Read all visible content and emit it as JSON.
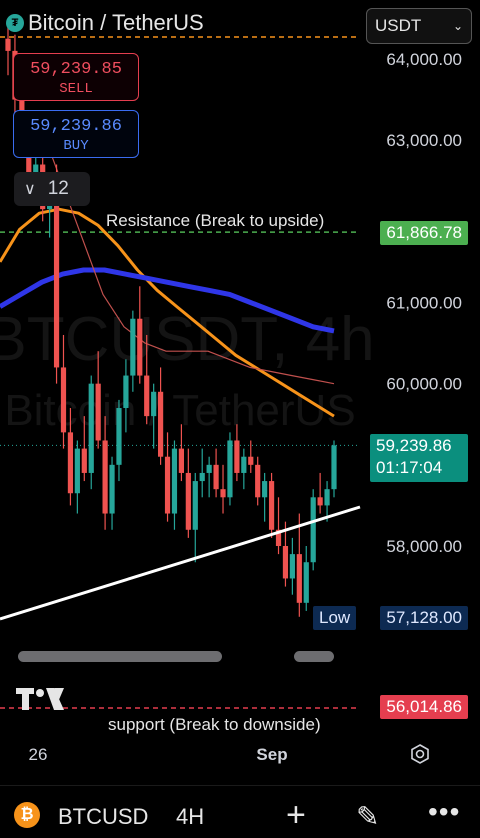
{
  "header": {
    "title": "Bitcoin / TetherUS",
    "quote_select": "USDT"
  },
  "trade": {
    "sell_price": "59,239.85",
    "sell_label": "SELL",
    "buy_price": "59,239.86",
    "buy_label": "BUY",
    "indicator_count": "12"
  },
  "watermark": {
    "line1": "BTCUSDT, 4h",
    "line2": "Bitcoin / TetherUS"
  },
  "price_tags": {
    "resistance": "61,866.78",
    "last": "59,239.86",
    "countdown": "01:17:04",
    "low_label": "Low",
    "low": "57,128.00",
    "support": "56,014.86"
  },
  "annotations": {
    "resistance": "Resistance (Break to upside)",
    "support": "support (Break to downside)"
  },
  "footer": {
    "symbol": "BTCUSD",
    "interval": "4H"
  },
  "colors": {
    "up": "#26a69a",
    "down": "#ef5350",
    "ema_orange": "#f7931a",
    "ma_blue": "#2f36e8",
    "ma_red": "#c0504d",
    "ma_green": "#4c9a4c",
    "resistance": "#4caf50",
    "support": "#e53e4f"
  },
  "chart_data": {
    "type": "candlestick",
    "title": "Bitcoin / TetherUS",
    "y_tick_labels": [
      "64,000.00",
      "63,000.00",
      "61,000.00",
      "60,000.00",
      "58,000.00"
    ],
    "x_tick_labels": [
      "26",
      "Sep"
    ],
    "ylim": [
      55900,
      64300
    ],
    "grid": false,
    "candles": [
      [
        64250,
        64400,
        63800,
        64100
      ],
      [
        64100,
        64300,
        63300,
        63500
      ],
      [
        63500,
        63900,
        62900,
        63100
      ],
      [
        63100,
        63300,
        62400,
        62600
      ],
      [
        62600,
        62900,
        62300,
        62700
      ],
      [
        62700,
        62800,
        62000,
        62150
      ],
      [
        62150,
        62600,
        61800,
        62400
      ],
      [
        62300,
        62700,
        60000,
        60200
      ],
      [
        60200,
        60600,
        59200,
        59400
      ],
      [
        59400,
        59700,
        58500,
        58650
      ],
      [
        58650,
        59300,
        58400,
        59200
      ],
      [
        59200,
        59600,
        58800,
        58900
      ],
      [
        58900,
        60100,
        58700,
        60000
      ],
      [
        60000,
        60400,
        59200,
        59300
      ],
      [
        59300,
        59600,
        58200,
        58400
      ],
      [
        58400,
        59100,
        58200,
        59000
      ],
      [
        59000,
        59800,
        58800,
        59700
      ],
      [
        59700,
        60300,
        59400,
        60100
      ],
      [
        60100,
        60900,
        59900,
        60800
      ],
      [
        60800,
        61200,
        60000,
        60100
      ],
      [
        60100,
        60600,
        59500,
        59600
      ],
      [
        59600,
        60000,
        59200,
        59900
      ],
      [
        59900,
        60200,
        59000,
        59100
      ],
      [
        59100,
        59400,
        58300,
        58400
      ],
      [
        58400,
        59300,
        58200,
        59200
      ],
      [
        59200,
        59500,
        58800,
        58900
      ],
      [
        58900,
        59200,
        58100,
        58200
      ],
      [
        58200,
        58900,
        57800,
        58800
      ],
      [
        58800,
        59200,
        58600,
        58900
      ],
      [
        58900,
        59100,
        58600,
        59000
      ],
      [
        59000,
        59200,
        58600,
        58700
      ],
      [
        58700,
        59000,
        58400,
        58600
      ],
      [
        58600,
        59400,
        58500,
        59300
      ],
      [
        59300,
        59500,
        58800,
        58900
      ],
      [
        58900,
        59200,
        58700,
        59100
      ],
      [
        59100,
        59300,
        58900,
        59000
      ],
      [
        59000,
        59100,
        58500,
        58600
      ],
      [
        58600,
        58900,
        58300,
        58800
      ],
      [
        58800,
        58900,
        58100,
        58200
      ],
      [
        58200,
        58600,
        57900,
        58000
      ],
      [
        58000,
        58300,
        57500,
        57600
      ],
      [
        57600,
        58100,
        57400,
        57900
      ],
      [
        57900,
        58400,
        57128,
        57300
      ],
      [
        57300,
        58000,
        57200,
        57800
      ],
      [
        57800,
        58700,
        57700,
        58600
      ],
      [
        58600,
        58900,
        58400,
        58500
      ],
      [
        58500,
        58800,
        58300,
        58700
      ],
      [
        58700,
        59300,
        58600,
        59240
      ]
    ],
    "series": [
      {
        "values": [
          61500,
          61900,
          62100,
          62150,
          62100,
          61950,
          61700,
          61400,
          61150,
          60950,
          60750,
          60550,
          60350,
          60200,
          60050,
          59900,
          59750,
          59600
        ]
      },
      {
        "values": [
          60950,
          61100,
          61250,
          61350,
          61400,
          61400,
          61350,
          61300,
          61250,
          61200,
          61150,
          61100,
          61000,
          60900,
          60800,
          60700,
          60650
        ]
      },
      {
        "values": [
          63200,
          62500,
          61800,
          61100,
          60700,
          60500,
          60400,
          60400,
          60400,
          60300,
          60200,
          60150,
          60100,
          60050,
          60000
        ]
      }
    ]
  }
}
